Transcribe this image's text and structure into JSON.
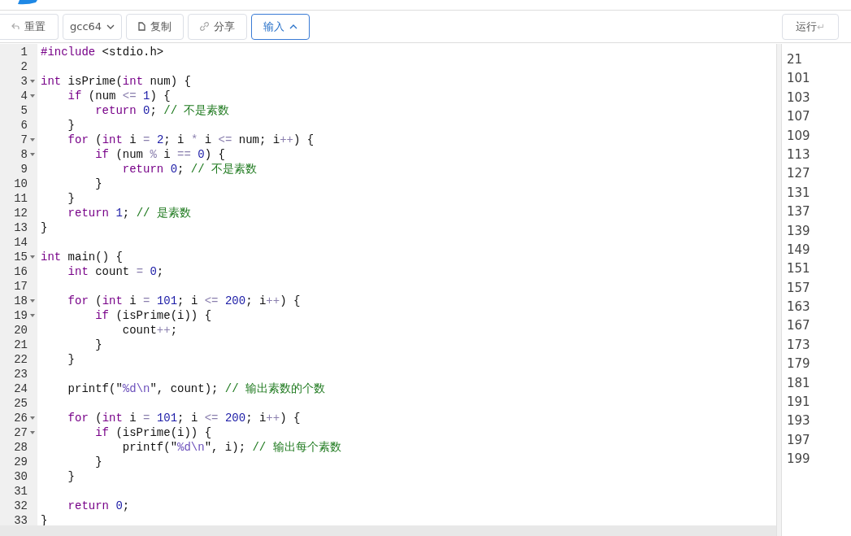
{
  "toolbar": {
    "buttons": [
      {
        "kind": "reset",
        "label": "重置",
        "active": false
      },
      {
        "kind": "select",
        "label": "gcc64",
        "active": false
      },
      {
        "kind": "copy",
        "label": "复制",
        "active": false
      },
      {
        "kind": "share",
        "label": "分享",
        "active": false
      },
      {
        "kind": "input",
        "label": "输入",
        "active": true
      }
    ],
    "run": {
      "label": "运行",
      "shortcut": "↵"
    }
  },
  "editor": {
    "lines": [
      {
        "number": "1",
        "foldable": false,
        "tokens": [
          {
            "kind": "meta",
            "text": "#include"
          },
          {
            "kind": "plain",
            "text": " <stdio.h>"
          }
        ]
      },
      {
        "number": "2",
        "foldable": false
      },
      {
        "number": "3",
        "foldable": true,
        "tokens": [
          {
            "kind": "keyword",
            "text": "int"
          },
          {
            "kind": "plain",
            "text": " isPrime("
          },
          {
            "kind": "keyword",
            "text": "int"
          },
          {
            "kind": "plain",
            "text": " num) {"
          }
        ]
      },
      {
        "number": "4",
        "foldable": true,
        "tokens": [
          {
            "kind": "keyword",
            "text": "    if"
          },
          {
            "kind": "plain",
            "text": " (num "
          },
          {
            "kind": "operator",
            "text": "<= "
          },
          {
            "kind": "number",
            "text": "1"
          },
          {
            "kind": "plain",
            "text": ") {"
          }
        ]
      },
      {
        "number": "5",
        "foldable": false,
        "tokens": [
          {
            "kind": "keyword",
            "text": "        return "
          },
          {
            "kind": "number",
            "text": "0"
          },
          {
            "kind": "plain",
            "text": "; "
          },
          {
            "kind": "comment",
            "text": "// 不是素数"
          }
        ]
      },
      {
        "number": "6",
        "foldable": false,
        "tokens": [
          {
            "kind": "plain",
            "text": "    }"
          }
        ]
      },
      {
        "number": "7",
        "foldable": true,
        "tokens": [
          {
            "kind": "keyword",
            "text": "    for"
          },
          {
            "kind": "plain",
            "text": " ("
          },
          {
            "kind": "keyword",
            "text": "int"
          },
          {
            "kind": "plain",
            "text": " i "
          },
          {
            "kind": "operator",
            "text": "= "
          },
          {
            "kind": "number",
            "text": "2"
          },
          {
            "kind": "plain",
            "text": "; i "
          },
          {
            "kind": "operator",
            "text": "*"
          },
          {
            "kind": "plain",
            "text": " i "
          },
          {
            "kind": "operator",
            "text": "<="
          },
          {
            "kind": "plain",
            "text": " num; i"
          },
          {
            "kind": "operator",
            "text": "++"
          },
          {
            "kind": "plain",
            "text": ") {"
          }
        ]
      },
      {
        "number": "8",
        "foldable": true,
        "tokens": [
          {
            "kind": "keyword",
            "text": "        if"
          },
          {
            "kind": "plain",
            "text": " (num "
          },
          {
            "kind": "operator",
            "text": "%"
          },
          {
            "kind": "plain",
            "text": " i "
          },
          {
            "kind": "operator",
            "text": "== "
          },
          {
            "kind": "number",
            "text": "0"
          },
          {
            "kind": "plain",
            "text": ") {"
          }
        ]
      },
      {
        "number": "9",
        "foldable": false,
        "tokens": [
          {
            "kind": "keyword",
            "text": "            return "
          },
          {
            "kind": "number",
            "text": "0"
          },
          {
            "kind": "plain",
            "text": "; "
          },
          {
            "kind": "comment",
            "text": "// 不是素数"
          }
        ]
      },
      {
        "number": "10",
        "foldable": false,
        "tokens": [
          {
            "kind": "plain",
            "text": "        }"
          }
        ]
      },
      {
        "number": "11",
        "foldable": false,
        "tokens": [
          {
            "kind": "plain",
            "text": "    }"
          }
        ]
      },
      {
        "number": "12",
        "foldable": false,
        "tokens": [
          {
            "kind": "keyword",
            "text": "    return "
          },
          {
            "kind": "number",
            "text": "1"
          },
          {
            "kind": "plain",
            "text": "; "
          },
          {
            "kind": "comment",
            "text": "// 是素数"
          }
        ]
      },
      {
        "number": "13",
        "foldable": false,
        "tokens": [
          {
            "kind": "plain",
            "text": "}"
          }
        ]
      },
      {
        "number": "14",
        "foldable": false
      },
      {
        "number": "15",
        "foldable": true,
        "tokens": [
          {
            "kind": "keyword",
            "text": "int"
          },
          {
            "kind": "plain",
            "text": " main() {"
          }
        ]
      },
      {
        "number": "16",
        "foldable": false,
        "tokens": [
          {
            "kind": "keyword",
            "text": "    int"
          },
          {
            "kind": "plain",
            "text": " count "
          },
          {
            "kind": "operator",
            "text": "= "
          },
          {
            "kind": "number",
            "text": "0"
          },
          {
            "kind": "plain",
            "text": ";"
          }
        ]
      },
      {
        "number": "17",
        "foldable": false
      },
      {
        "number": "18",
        "foldable": true,
        "tokens": [
          {
            "kind": "keyword",
            "text": "    for"
          },
          {
            "kind": "plain",
            "text": " ("
          },
          {
            "kind": "keyword",
            "text": "int"
          },
          {
            "kind": "plain",
            "text": " i "
          },
          {
            "kind": "operator",
            "text": "= "
          },
          {
            "kind": "number",
            "text": "101"
          },
          {
            "kind": "plain",
            "text": "; i "
          },
          {
            "kind": "operator",
            "text": "<= "
          },
          {
            "kind": "number",
            "text": "200"
          },
          {
            "kind": "plain",
            "text": "; i"
          },
          {
            "kind": "operator",
            "text": "++"
          },
          {
            "kind": "plain",
            "text": ") {"
          }
        ]
      },
      {
        "number": "19",
        "foldable": true,
        "tokens": [
          {
            "kind": "keyword",
            "text": "        if"
          },
          {
            "kind": "plain",
            "text": " (isPrime(i)) {"
          }
        ]
      },
      {
        "number": "20",
        "foldable": false,
        "tokens": [
          {
            "kind": "plain",
            "text": "            count"
          },
          {
            "kind": "operator",
            "text": "++"
          },
          {
            "kind": "plain",
            "text": ";"
          }
        ]
      },
      {
        "number": "21",
        "foldable": false,
        "tokens": [
          {
            "kind": "plain",
            "text": "        }"
          }
        ]
      },
      {
        "number": "22",
        "foldable": false,
        "tokens": [
          {
            "kind": "plain",
            "text": "    }"
          }
        ]
      },
      {
        "number": "23",
        "foldable": false
      },
      {
        "number": "24",
        "foldable": false,
        "tokens": [
          {
            "kind": "plain",
            "text": "    printf(\""
          },
          {
            "kind": "string",
            "text": "%d\\n"
          },
          {
            "kind": "plain",
            "text": "\", count); "
          },
          {
            "kind": "comment",
            "text": "// 输出素数的个数"
          }
        ]
      },
      {
        "number": "25",
        "foldable": false
      },
      {
        "number": "26",
        "foldable": true,
        "tokens": [
          {
            "kind": "keyword",
            "text": "    for"
          },
          {
            "kind": "plain",
            "text": " ("
          },
          {
            "kind": "keyword",
            "text": "int"
          },
          {
            "kind": "plain",
            "text": " i "
          },
          {
            "kind": "operator",
            "text": "= "
          },
          {
            "kind": "number",
            "text": "101"
          },
          {
            "kind": "plain",
            "text": "; i "
          },
          {
            "kind": "operator",
            "text": "<= "
          },
          {
            "kind": "number",
            "text": "200"
          },
          {
            "kind": "plain",
            "text": "; i"
          },
          {
            "kind": "operator",
            "text": "++"
          },
          {
            "kind": "plain",
            "text": ") {"
          }
        ]
      },
      {
        "number": "27",
        "foldable": true,
        "tokens": [
          {
            "kind": "keyword",
            "text": "        if"
          },
          {
            "kind": "plain",
            "text": " (isPrime(i)) {"
          }
        ]
      },
      {
        "number": "28",
        "foldable": false,
        "tokens": [
          {
            "kind": "plain",
            "text": "            printf(\""
          },
          {
            "kind": "string",
            "text": "%d\\n"
          },
          {
            "kind": "plain",
            "text": "\", i); "
          },
          {
            "kind": "comment",
            "text": "// 输出每个素数"
          }
        ]
      },
      {
        "number": "29",
        "foldable": false,
        "tokens": [
          {
            "kind": "plain",
            "text": "        }"
          }
        ]
      },
      {
        "number": "30",
        "foldable": false,
        "tokens": [
          {
            "kind": "plain",
            "text": "    }"
          }
        ]
      },
      {
        "number": "31",
        "foldable": false
      },
      {
        "number": "32",
        "foldable": false,
        "tokens": [
          {
            "kind": "keyword",
            "text": "    return "
          },
          {
            "kind": "number",
            "text": "0"
          },
          {
            "kind": "plain",
            "text": ";"
          }
        ]
      },
      {
        "number": "33",
        "foldable": false,
        "tokens": [
          {
            "kind": "plain",
            "text": "}"
          }
        ]
      }
    ]
  },
  "output": {
    "lines": [
      "21",
      "101",
      "103",
      "107",
      "109",
      "113",
      "127",
      "131",
      "137",
      "139",
      "149",
      "151",
      "157",
      "163",
      "167",
      "173",
      "179",
      "181",
      "191",
      "193",
      "197",
      "199"
    ]
  }
}
